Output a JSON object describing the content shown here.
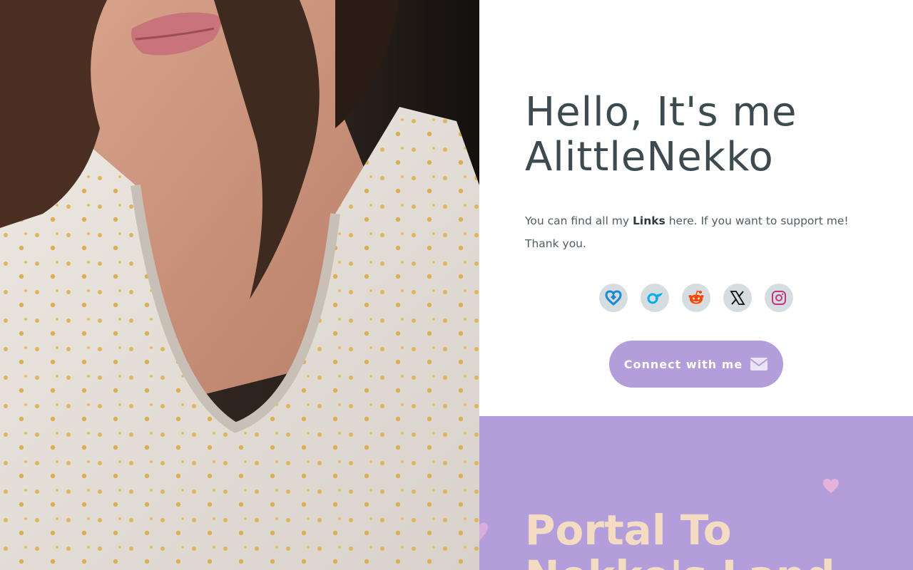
{
  "hero": {
    "title_line1": "Hello, It's me",
    "title_line2": "AlittleNekko",
    "text_before": "You can find all my ",
    "text_bold": "Links",
    "text_after": " here. If you want to support me! Thank you."
  },
  "socials": [
    {
      "name": "patreon-icon",
      "color": "#1a8ad4"
    },
    {
      "name": "onlyfans-icon",
      "color": "#00aff0"
    },
    {
      "name": "reddit-icon",
      "color": "#ff4500"
    },
    {
      "name": "x-icon",
      "color": "#000000"
    },
    {
      "name": "instagram-icon",
      "color": "#c13584"
    }
  ],
  "connect": {
    "label": "Connect with me",
    "icon": "envelope-icon"
  },
  "portal": {
    "title_line1": "Portal To",
    "title_line2": "Nekko's Land"
  },
  "colors": {
    "accent": "#b39ddb",
    "heading": "#3d4a4f",
    "portal_text": "#f3dcc2",
    "heart": "#e8b4d8"
  }
}
